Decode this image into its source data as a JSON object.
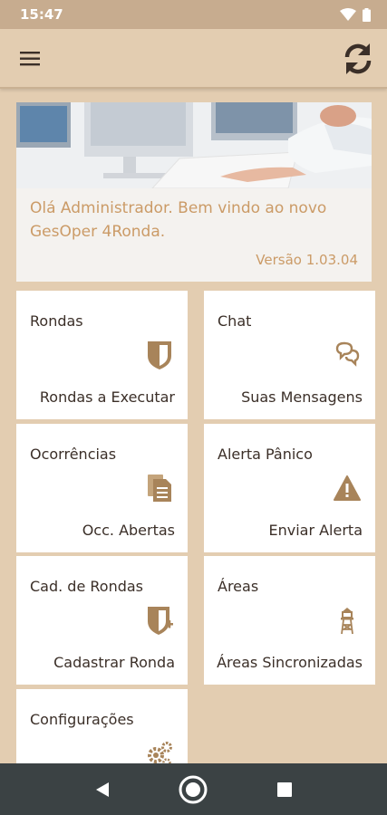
{
  "status_bar": {
    "time": "15:47",
    "icons": [
      "wifi-icon",
      "battery-icon"
    ]
  },
  "app_bar": {
    "menu_icon": "hamburger-menu-icon",
    "sync_icon": "sync-refresh-icon"
  },
  "banner": {
    "greeting": "Olá Administrador. Bem vindo ao novo GesOper 4Ronda.",
    "version": "Versão 1.03.04"
  },
  "cards": [
    {
      "title": "Rondas",
      "subtitle": "Rondas a Executar",
      "icon": "shield-icon"
    },
    {
      "title": "Chat",
      "subtitle": "Suas Mensagens",
      "icon": "chat-bubbles-icon"
    },
    {
      "title": "Ocorrências",
      "subtitle": "Occ. Abertas",
      "icon": "documents-icon"
    },
    {
      "title": "Alerta Pânico",
      "subtitle": "Enviar Alerta",
      "icon": "warning-icon"
    },
    {
      "title": "Cad. de Rondas",
      "subtitle": "Cadastrar Ronda",
      "icon": "shield-add-icon"
    },
    {
      "title": "Áreas",
      "subtitle": "Áreas Sincronizadas",
      "icon": "watchtower-icon"
    },
    {
      "title": "Configurações",
      "subtitle": "",
      "icon": "gears-icon"
    }
  ],
  "nav_bar": {
    "back": "back-triangle-icon",
    "home": "home-circle-icon",
    "recents": "recents-square-icon"
  },
  "colors": {
    "accent": "#a8845a",
    "banner_text": "#cb9b67",
    "background": "#e3cdb1",
    "status_bar": "#c7ac8f",
    "nav_bar": "#3b4244"
  }
}
